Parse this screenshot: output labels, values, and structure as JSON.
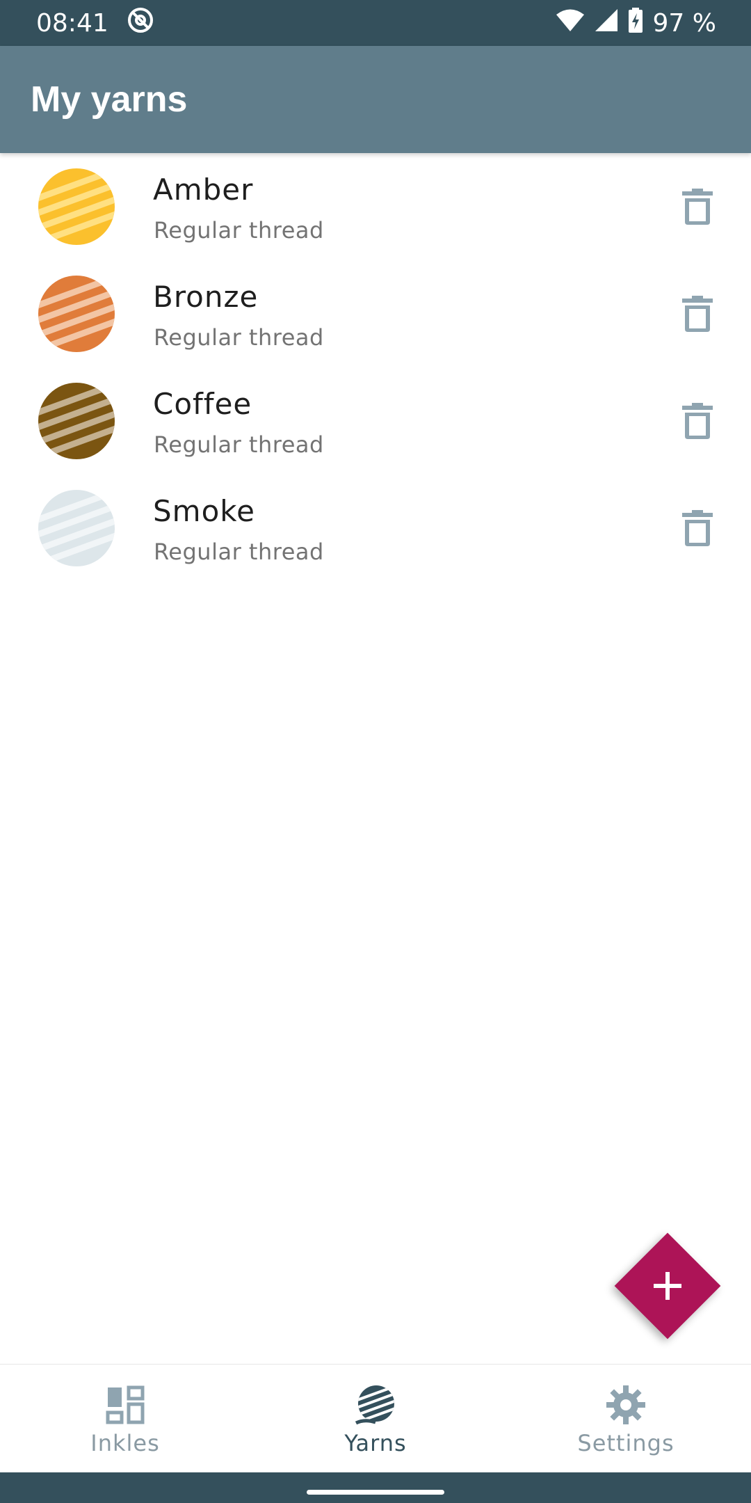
{
  "status": {
    "time": "08:41",
    "battery": "97 %"
  },
  "header": {
    "title": "My yarns"
  },
  "yarns": [
    {
      "name": "Amber",
      "type": "Regular thread",
      "color": "#fbc02d",
      "stripe": "#ffe082"
    },
    {
      "name": "Bronze",
      "type": "Regular thread",
      "color": "#e07c3a",
      "stripe": "#f3c5a4"
    },
    {
      "name": "Coffee",
      "type": "Regular thread",
      "color": "#7b5511",
      "stripe": "#c4b08f"
    },
    {
      "name": "Smoke",
      "type": "Regular thread",
      "color": "#dde6ea",
      "stripe": "#f1f5f7"
    }
  ],
  "icons": {
    "delete": "trash-icon",
    "add": "plus-icon",
    "colors": {
      "accent": "#ad1457",
      "app_bar": "#607d8b",
      "status_bar": "#34505c",
      "icon_grey": "#8fa4b0"
    }
  },
  "nav": {
    "items": [
      {
        "label": "Inkles",
        "icon": "dashboard-icon",
        "active": false
      },
      {
        "label": "Yarns",
        "icon": "yarn-ball-icon",
        "active": true
      },
      {
        "label": "Settings",
        "icon": "gear-icon",
        "active": false
      }
    ]
  }
}
